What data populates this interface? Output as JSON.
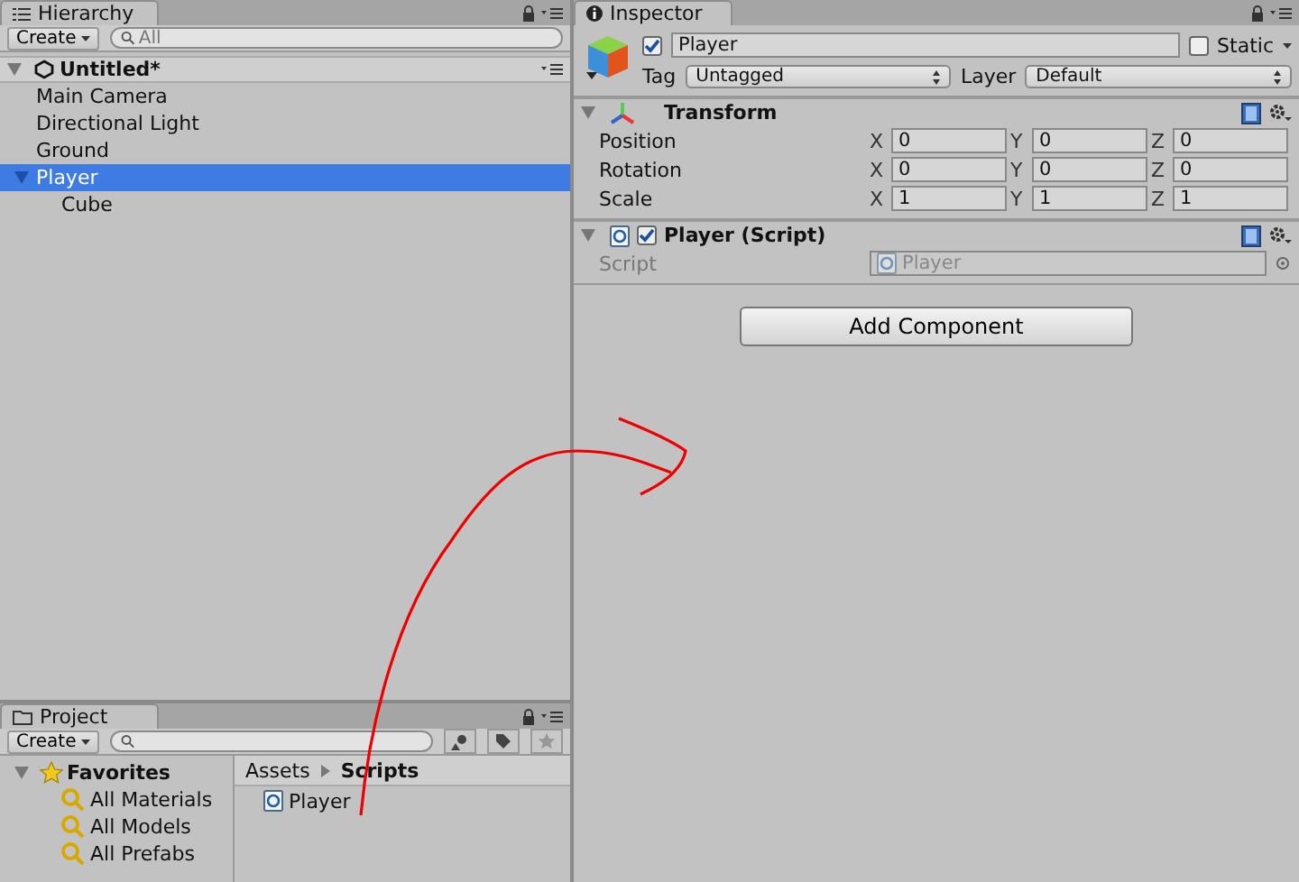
{
  "hierarchy": {
    "tab": "Hierarchy",
    "create": "Create",
    "search_placeholder": "All",
    "scene": "Untitled*",
    "items": [
      {
        "label": "Main Camera",
        "selected": false
      },
      {
        "label": "Directional Light",
        "selected": false
      },
      {
        "label": "Ground",
        "selected": false
      },
      {
        "label": "Player",
        "selected": true,
        "expanded": true,
        "children": [
          {
            "label": "Cube",
            "selected": false
          }
        ]
      }
    ]
  },
  "inspector": {
    "tab": "Inspector",
    "active": true,
    "name": "Player",
    "static_label": "Static",
    "static": false,
    "tag_label": "Tag",
    "tag": "Untagged",
    "layer_label": "Layer",
    "layer": "Default",
    "components": [
      {
        "kind": "transform",
        "title": "Transform",
        "rows": [
          {
            "label": "Position",
            "fields": [
              {
                "axis": "X",
                "value": "0"
              },
              {
                "axis": "Y",
                "value": "0"
              },
              {
                "axis": "Z",
                "value": "0"
              }
            ]
          },
          {
            "label": "Rotation",
            "fields": [
              {
                "axis": "X",
                "value": "0"
              },
              {
                "axis": "Y",
                "value": "0"
              },
              {
                "axis": "Z",
                "value": "0"
              }
            ]
          },
          {
            "label": "Scale",
            "fields": [
              {
                "axis": "X",
                "value": "1"
              },
              {
                "axis": "Y",
                "value": "1"
              },
              {
                "axis": "Z",
                "value": "1"
              }
            ]
          }
        ]
      },
      {
        "kind": "script",
        "title": "Player (Script)",
        "enabled": true,
        "field_label": "Script",
        "field_value": "Player"
      }
    ],
    "add_component": "Add Component"
  },
  "project": {
    "tab": "Project",
    "create": "Create",
    "favorites": {
      "label": "Favorites",
      "expanded": true,
      "items": [
        "All Materials",
        "All Models",
        "All Prefabs"
      ]
    },
    "breadcrumb": [
      "Assets",
      "Scripts"
    ],
    "files": [
      {
        "name": "Player"
      }
    ]
  }
}
